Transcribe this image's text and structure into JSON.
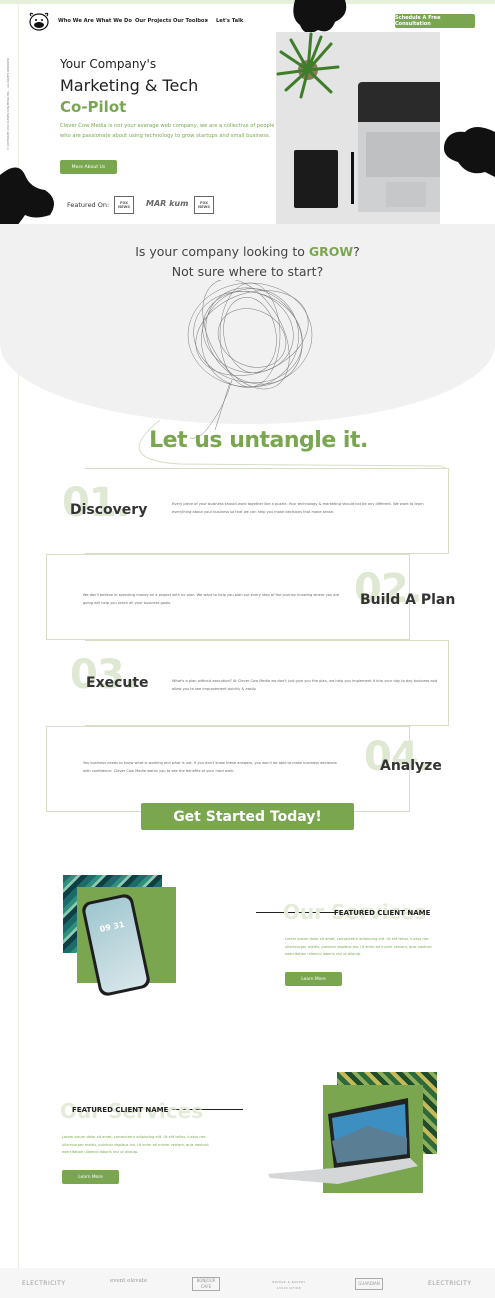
{
  "nav": {
    "items": [
      "Who We Are",
      "What We Do",
      "Our Projects",
      "Our Toolbox",
      "Let's Talk"
    ],
    "cta": "Schedule A Free Consultation"
  },
  "side": {
    "text": "© COPYRIGHT 2023 CLEVER COW MEDIA INC. - ALL RIGHTS RESERVED"
  },
  "hero": {
    "line1": "Your Company's",
    "line2": "Marketing & Tech",
    "line3": "Co-Pilot",
    "description": "Clever Cow Media is not your average web company, we are a collective of people who are passionate about using technology to grow startups and small business.",
    "button": "More About Us",
    "featured_label": "Featured On:",
    "featured_logos": [
      "FOX NEWS",
      "MAR kum",
      "FOX NEWS"
    ]
  },
  "question": {
    "line1_prefix": "Is your company looking to ",
    "line1_highlight": "GROW",
    "line1_suffix": "?",
    "line2": "Not sure where to start?"
  },
  "untangle": {
    "title": "Let us untangle it."
  },
  "steps": [
    {
      "num": "01.",
      "title": "Discovery",
      "text": "Every piece of your business should work together like a puzzle. Your technology & marketing should not be any different. We want to learn everything about your business so that we can help you make decisions that make sense."
    },
    {
      "num": "02.",
      "title": "Build A Plan",
      "text": "We don't believe in spending money on a project with no plan. We want to help you plan out every step of the journey knowing where you are going will help you reach all your business goals."
    },
    {
      "num": "03.",
      "title": "Execute",
      "text": "What's a plan without execution? At Clever Cow Media we don't just give you the plan, we help you implement it into your day to day business and allow you to see improvement quickly & easily."
    },
    {
      "num": "04.",
      "title": "Analyze",
      "text": "You business needs to know what is working and what is not. If you don't know these answers, you won't be able to make business decisions with confidence. Clever Cow Media wants you to see the benefits of your hard work."
    }
  ],
  "get_started": {
    "label": "Get Started Today!"
  },
  "services": [
    {
      "watermark": "Our Services",
      "label": "FEATURED CLIENT NAME",
      "text": "Lorem ipsum dolor sit amet, consectetur adipiscing elit. Ut elit tellus, luctus nec ullamcorper mattis, pulvinar dapibus leo. Ut enim ad minim veniam, quis nostrud exercitation ullamco laboris nisi ut aliquip.",
      "button": "Learn More",
      "phone_time": "09 31"
    },
    {
      "watermark": "Our Services",
      "label": "FEATURED CLIENT NAME",
      "text": "Lorem ipsum dolor sit amet, consectetur adipiscing elit. Ut elit tellus, luctus nec ullamcorper mattis, pulvinar dapibus leo. Ut enim ad minim veniam, quis nostrud exercitation ullamco laboris nisi ut aliquip.",
      "button": "Learn More"
    }
  ],
  "footer_logos": [
    "ELECTRICITY",
    "event elevate",
    "BONJOUR CAFE",
    "BRIDGE & BAKERY ASSOCIATION",
    "GUARDIAN",
    "ELECTRICITY"
  ],
  "colors": {
    "accent": "#7aa650",
    "watermark": "#e3ecd8",
    "black": "#111111"
  }
}
